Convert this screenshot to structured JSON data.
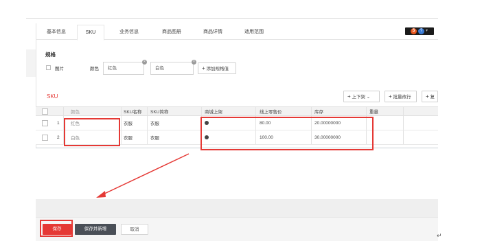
{
  "tabs": [
    {
      "label": "基本信息",
      "active": false
    },
    {
      "label": "SKU",
      "active": true
    },
    {
      "label": "业务信息",
      "active": false
    },
    {
      "label": "商品图册",
      "active": false
    },
    {
      "label": "商品详情",
      "active": false
    },
    {
      "label": "适用范围",
      "active": false
    }
  ],
  "spec": {
    "title": "规格",
    "image_checkbox_label": "图片",
    "color_label": "颜色",
    "color_values": [
      "红色",
      "白色"
    ],
    "add_spec_label": "添加规格值"
  },
  "sku": {
    "title": "SKU",
    "toolbar": {
      "shelf_button": "上下架",
      "batch_modify_button": "批量改行",
      "third_button": "复"
    },
    "columns": [
      "颜色",
      "SKU名称",
      "SKU简称",
      "商城上架",
      "线上零售价",
      "库存",
      "重量"
    ],
    "rows": [
      {
        "index": "1",
        "color": "红色",
        "name": "衣服",
        "short_name": "衣服",
        "online_price": "80.00",
        "stock": "20.00000000"
      },
      {
        "index": "2",
        "color": "白色",
        "name": "衣服",
        "short_name": "衣服",
        "online_price": "100.00",
        "stock": "30.00000000"
      }
    ]
  },
  "footer": {
    "save": "保存",
    "save_and_new": "保存并新增",
    "cancel": "取消"
  },
  "icons": [
    "s-brand-icon",
    "help-icon",
    "dropdown-icon",
    "plus-icon",
    "chevron-down-icon",
    "close-icon",
    "checkbox-icon"
  ],
  "colors": {
    "accent_red": "#e53935",
    "save_red": "#e53935",
    "dark_button": "#4a4f57",
    "header_gray": "#f2f2f2"
  }
}
